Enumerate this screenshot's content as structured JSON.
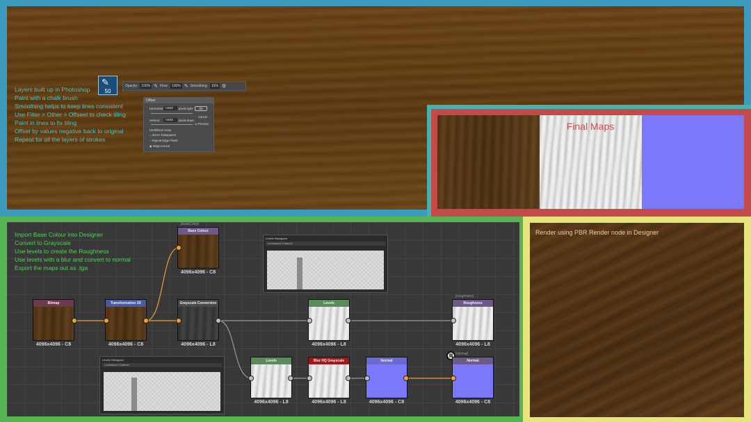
{
  "photoshop": {
    "notes": [
      "Layers built up in Photoshop",
      "Paint with a chalk brush",
      "Smoothing helps to keep lines consistent",
      "Use Filter > Other > Offseet to check tiling",
      "Paint in lines to fix tiling",
      "Offset by values negative back to original",
      "Repeat for all the layers of strokes"
    ],
    "brush_size": "50",
    "toolbar": {
      "opacity_label": "Opacity:",
      "opacity_value": "100%",
      "flow_label": "Flow:",
      "flow_value": "100%",
      "smoothing_label": "Smoothing:",
      "smoothing_value": "15%"
    },
    "offset_dialog": {
      "title": "Offset",
      "horizontal_label": "Horizontal:",
      "horizontal_value": "+2048",
      "horizontal_unit": "pixels right",
      "vertical_label": "Vertical:",
      "vertical_value": "+2048",
      "vertical_unit": "pixels down",
      "ok": "OK",
      "cancel": "Cancel",
      "preview": "Preview",
      "undefined_areas": "Undefined Areas",
      "opt_transparent": "Set to Transparent",
      "opt_repeat": "Repeat Edge Pixels",
      "opt_wrap": "Wrap Around"
    }
  },
  "final_maps": {
    "title": "Final Maps"
  },
  "designer": {
    "notes": [
      "Import Base Colour into Designer",
      "Convert to Grayscale",
      "Use levels to create the Roughness",
      "Use levels with a blur and convert to normal",
      "Export the maps out as .tga"
    ],
    "nodes": {
      "bitmap": {
        "title": "Bitmap",
        "size": "4096x4096 - C8"
      },
      "transformation": {
        "title": "Transformation 2D",
        "size": "4096x4096 - C8"
      },
      "base_colour": {
        "title": "Base Colour",
        "size": "4096x4096 - C8",
        "tag": "[baseColor]"
      },
      "grayscale": {
        "title": "Grayscale Conversion",
        "size": "4096x4096 - L8"
      },
      "levels_top": {
        "title": "Levels",
        "size": "4096x4096 - L8"
      },
      "roughness": {
        "title": "Roughness",
        "size": "4096x4096 - L8",
        "tag": "[roughness]"
      },
      "levels_bottom": {
        "title": "Levels",
        "size": "4096x4096 - L8"
      },
      "blur": {
        "title": "Blur HQ Grayscale",
        "size": "4096x4096 - L8"
      },
      "normal_filter": {
        "title": "Normal",
        "size": "4096x4096 - C8"
      },
      "normal_output": {
        "title": "Normal",
        "size": "4096x4096 - C8",
        "tag": "[normal]"
      }
    },
    "histogram_top": {
      "title": "Levels Histogram",
      "channel": "Luminance Channel"
    },
    "histogram_bottom": {
      "title": "Levels Histogram",
      "channel": "Luminance Channel"
    },
    "colors": {
      "bitmap": "#6a3a50",
      "transformation": "#4a5aa0",
      "base_colour": "#6e5a8a",
      "grayscale": "#4a4a4a",
      "levels": "#5b8a5b",
      "roughness": "#6e5a8a",
      "blur": "#a01818",
      "normal_filter": "#6a6ad0",
      "normal_output": "#6e5a8a",
      "link": "#f0a030",
      "link_gray": "#9a9a9a"
    }
  },
  "render": {
    "note": "Render using PBR Render node in Designer"
  }
}
